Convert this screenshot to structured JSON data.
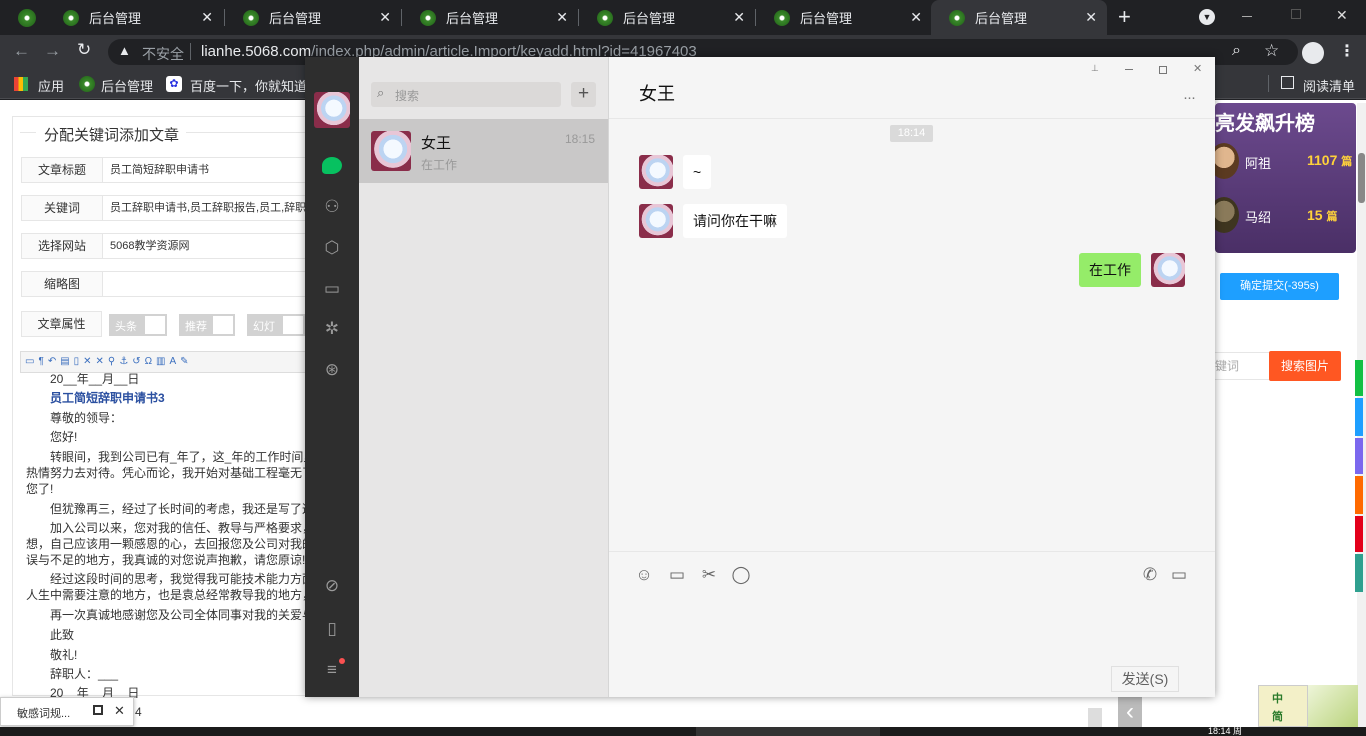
{
  "browser": {
    "tabs": [
      {
        "label": "后台管理"
      },
      {
        "label": "后台管理"
      },
      {
        "label": "后台管理"
      },
      {
        "label": "后台管理"
      },
      {
        "label": "后台管理"
      },
      {
        "label": "后台管理"
      }
    ],
    "new_tab": "+",
    "insecure_label": "不安全",
    "url_host": "lianhe.5068.com",
    "url_path": "/index.php/admin/article.Import/keyadd.html?id=41967403",
    "bookmarks": [
      {
        "label": "应用"
      },
      {
        "label": "后台管理"
      },
      {
        "label": "百度一下，你就知道"
      }
    ],
    "reading_list": "阅读清单"
  },
  "form": {
    "title": "分配关键词添加文章",
    "rows": [
      {
        "label": "文章标题",
        "value": "员工简短辞职申请书"
      },
      {
        "label": "关键词",
        "value": "员工辞职申请书,员工辞职报告,员工,辞职,辞"
      },
      {
        "label": "选择网站",
        "value": "5068教学资源网"
      },
      {
        "label": "缩略图",
        "value": ""
      }
    ],
    "attr_label": "文章属性",
    "attrs": [
      "头条",
      "推荐",
      "幻灯"
    ]
  },
  "editor": {
    "lines": [
      "20__年__月__日",
      "员工简短辞职申请书3",
      "尊敬的领导：",
      "您好!",
      "转眼间，我到公司已有_年了，这_年的工作时间里",
      "热情努力去对待。凭心而论，我开始对基础工程毫无了",
      "您了!",
      "但犹豫再三，经过了长时间的考虑，我还是写了这",
      "加入公司以来，您对我的信任、教导与严格要求，",
      "想，自己应该用一颗感恩的心，去回报您及公司对我的",
      "误与不足的地方，我真诚的对您说声抱歉，请您原谅!",
      "经过这段时间的思考，我觉得我可能技术能力方面",
      "人生中需要注意的地方，也是袁总经常教导我的地方，",
      "再一次真诚地感谢您及公司全体同事对我的关爱与",
      "此致",
      "敬礼!",
      "辞职人：___",
      "20__年__月__日"
    ],
    "page_num": "4"
  },
  "popup": {
    "label": "敏感词规...",
    "close": "✕"
  },
  "right": {
    "ranking_title": "亮发飙升榜",
    "rank": [
      {
        "name": "阿祖",
        "count": "1107",
        "unit": "篇"
      },
      {
        "name": "马绍",
        "count": "15",
        "unit": "篇"
      }
    ],
    "submit": "确定提交(-395s)",
    "keyword_placeholder": "键词",
    "search_images": "搜索图片",
    "ime_1": "中",
    "ime_2": "简"
  },
  "taskbar": {
    "time": "18:14 周"
  },
  "wechat": {
    "search_placeholder": "搜索",
    "add": "+",
    "contact": {
      "name": "女王",
      "time": "18:15",
      "preview": "在工作"
    },
    "chat_title": "女王",
    "more": "···",
    "timestamp": "18:14",
    "messages": [
      {
        "from": "other",
        "text": "~"
      },
      {
        "from": "other",
        "text": "请问你在干嘛"
      },
      {
        "from": "me",
        "text": "在工作"
      }
    ],
    "send": "发送(S)",
    "colors": {
      "accent": "#07c160",
      "sidebar": "#2e2e2e",
      "bubble_me": "#95ec69"
    }
  }
}
